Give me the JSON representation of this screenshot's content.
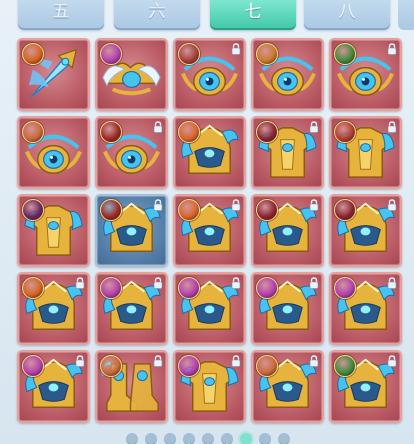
{
  "tabs": [
    {
      "label": "五",
      "active": false
    },
    {
      "label": "六",
      "active": false
    },
    {
      "label": "七",
      "active": true
    },
    {
      "label": "八",
      "active": false
    }
  ],
  "colors": {
    "slot_red": "#b75762",
    "slot_blue": "#4f79a3",
    "tab_active": "#41c6a9",
    "tab_inactive": "#aac8e4",
    "gold": "#e6b43c",
    "cyan": "#46c3f0"
  },
  "grid": {
    "rows": [
      [
        {
          "item": "winged-spear-icon",
          "badge": "flame-rune-icon",
          "badge_color": "#d4651e",
          "slot": "red",
          "locked": false
        },
        {
          "item": "winged-crown-icon",
          "badge": "ornate-rune-icon",
          "badge_color": "#b23fb0",
          "slot": "red",
          "locked": false
        },
        {
          "item": "jeweled-amulet-icon",
          "badge": "orb-rune-icon",
          "badge_color": "#a33f3a",
          "slot": "red",
          "locked": true
        },
        {
          "item": "jeweled-amulet-icon",
          "badge": "spiral-rune-icon",
          "badge_color": "#c97a2a",
          "slot": "red",
          "locked": false
        },
        {
          "item": "jeweled-amulet-icon",
          "badge": "wing-rune-icon",
          "badge_color": "#3f8b3a",
          "slot": "red",
          "locked": true
        }
      ],
      [
        {
          "item": "jeweled-amulet-icon",
          "badge": "figure-rune-icon",
          "badge_color": "#c9693a",
          "slot": "red",
          "locked": false
        },
        {
          "item": "jeweled-amulet-icon",
          "badge": "beast-rune-icon",
          "badge_color": "#9a2a22",
          "slot": "red",
          "locked": true
        },
        {
          "item": "dragon-helmet-icon",
          "badge": "swirl-rune-icon",
          "badge_color": "#d9652a",
          "slot": "red",
          "locked": false
        },
        {
          "item": "golden-armor-icon",
          "badge": "sword-rune-icon",
          "badge_color": "#8a2432",
          "slot": "red",
          "locked": true
        },
        {
          "item": "golden-armor-icon",
          "badge": "figure-rune-icon",
          "badge_color": "#b33d2c",
          "slot": "red",
          "locked": true
        }
      ],
      [
        {
          "item": "golden-armor-icon",
          "badge": "dark-rune-icon",
          "badge_color": "#6a2660",
          "slot": "red",
          "locked": false
        },
        {
          "item": "dragon-helmet-icon",
          "badge": "beast-rune-icon",
          "badge_color": "#9a2a22",
          "slot": "blue",
          "locked": true
        },
        {
          "item": "dragon-helmet-icon",
          "badge": "paw-rune-icon",
          "badge_color": "#d9652a",
          "slot": "red",
          "locked": true
        },
        {
          "item": "dragon-helmet-icon",
          "badge": "wolf-rune-icon",
          "badge_color": "#8a2432",
          "slot": "red",
          "locked": true
        },
        {
          "item": "dragon-helmet-icon",
          "badge": "moon-rune-icon",
          "badge_color": "#8a2432",
          "slot": "red",
          "locked": true
        }
      ],
      [
        {
          "item": "dragon-helmet-icon",
          "badge": "sun-rune-icon",
          "badge_color": "#d4651e",
          "slot": "red",
          "locked": true
        },
        {
          "item": "dragon-helmet-icon",
          "badge": "ornate-rune-icon",
          "badge_color": "#b23fb0",
          "slot": "red",
          "locked": true
        },
        {
          "item": "dragon-helmet-icon",
          "badge": "ornate-rune-icon",
          "badge_color": "#b23fb0",
          "slot": "red",
          "locked": true
        },
        {
          "item": "dragon-helmet-icon",
          "badge": "ornate-rune-icon",
          "badge_color": "#b23fb0",
          "slot": "red",
          "locked": true
        },
        {
          "item": "dragon-helmet-icon",
          "badge": "ornate-rune-icon",
          "badge_color": "#b23fb0",
          "slot": "red",
          "locked": true
        }
      ],
      [
        {
          "item": "dragon-helmet-icon",
          "badge": "ornate-rune-icon",
          "badge_color": "#b23fb0",
          "slot": "red",
          "locked": true
        },
        {
          "item": "golden-boots-icon",
          "badge": "warrior-rune-icon",
          "badge_color": "#c9693a",
          "slot": "red",
          "locked": true
        },
        {
          "item": "golden-armor-icon",
          "badge": "ornate-rune-icon",
          "badge_color": "#b23fb0",
          "slot": "red",
          "locked": true
        },
        {
          "item": "dragon-helmet-icon",
          "badge": "figure-rune-icon",
          "badge_color": "#c9693a",
          "slot": "red",
          "locked": true
        },
        {
          "item": "dragon-helmet-icon",
          "badge": "wing-rune-icon",
          "badge_color": "#3f8b3a",
          "slot": "red",
          "locked": true
        }
      ]
    ]
  },
  "pager": {
    "pages": 9,
    "active_page": 7
  }
}
